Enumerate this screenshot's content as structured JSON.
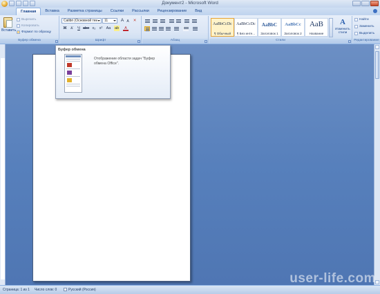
{
  "window": {
    "title": "Документ2 - Microsoft Word"
  },
  "tabs": [
    "Главная",
    "Вставка",
    "Разметка страницы",
    "Ссылки",
    "Рассылки",
    "Рецензирование",
    "Вид"
  ],
  "clipboard_group": {
    "paste_label": "Вставить",
    "cut_label": "Вырезать",
    "copy_label": "Копировать",
    "format_painter_label": "Формат по образцу",
    "group_label": "Буфер обмена"
  },
  "font_group": {
    "font_name": "Calibri (Основной тек",
    "font_size": "11",
    "bold": "Ж",
    "italic": "К",
    "underline": "Ч",
    "strike": "abe",
    "subscript": "x₂",
    "superscript": "x²",
    "change_case": "Aa",
    "grow": "A",
    "shrink": "A",
    "group_label": "Шрифт"
  },
  "paragraph_group": {
    "group_label": "Абзац"
  },
  "styles_group": {
    "styles": [
      {
        "sample": "AaBbCcDc",
        "name": "¶ Обычный",
        "selected": true
      },
      {
        "sample": "AaBbCcDc",
        "name": "¶ Без инте...",
        "selected": false
      },
      {
        "sample": "AaBbC",
        "name": "Заголовок 1",
        "selected": false
      },
      {
        "sample": "AaBbCc",
        "name": "Заголовок 2",
        "selected": false
      },
      {
        "sample": "АаВ",
        "name": "Название",
        "selected": false
      }
    ],
    "change_styles_label": "Изменить стили",
    "group_label": "Стили"
  },
  "editing_group": {
    "find_label": "Найти",
    "replace_label": "Заменить",
    "select_label": "Выделить",
    "group_label": "Редактирование"
  },
  "tooltip": {
    "title": "Буфер обмена",
    "description": "Отображение области задач \"Буфер обмена Office\"."
  },
  "statusbar": {
    "page": "Страница: 1 из 1",
    "words": "Число слов: 0",
    "language": "Русский (Россия)"
  },
  "watermark": "user-life.com"
}
